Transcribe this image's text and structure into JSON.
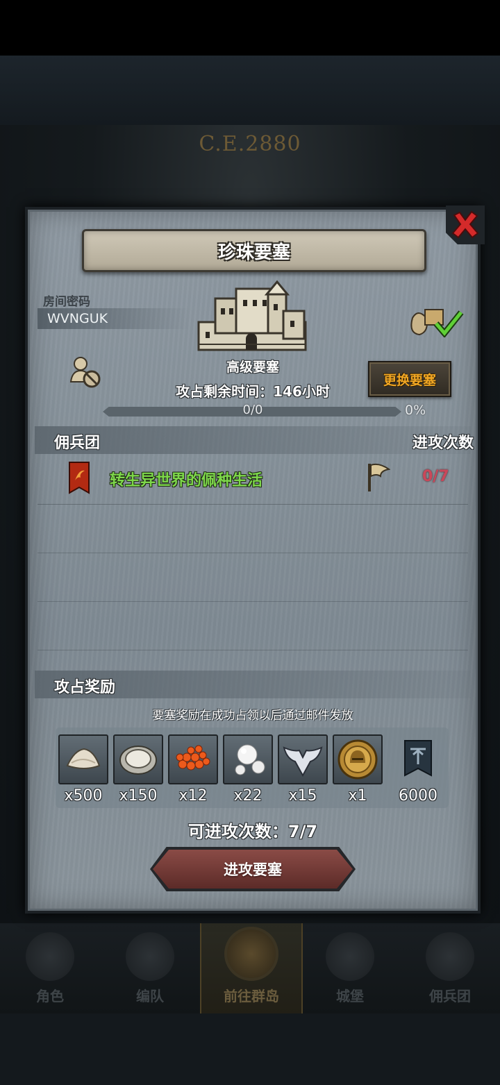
{
  "background": {
    "year_text": "C.E.2880"
  },
  "bottom_nav": {
    "items": [
      {
        "label": "角色",
        "icon": "knight-icon",
        "active": false
      },
      {
        "label": "编队",
        "icon": "helmet-icon",
        "active": false
      },
      {
        "label": "前往群岛",
        "icon": "globe-icon",
        "active": true
      },
      {
        "label": "城堡",
        "icon": "castle-icon",
        "active": false
      },
      {
        "label": "佣兵团",
        "icon": "warrior-icon",
        "active": false
      }
    ]
  },
  "dialog": {
    "title": "珍珠要塞",
    "room": {
      "label": "房间密码",
      "code": "WVNGUK"
    },
    "fortress": {
      "type": "高级要塞",
      "icon": "castle-icon",
      "change_button": "更换要塞",
      "remaining_time": "攻占剩余时间：146小时",
      "progress_text": "0/0",
      "progress_percent": "0%",
      "progress_value": 0
    },
    "mercenary_section": {
      "header_left": "佣兵团",
      "header_right": "进攻次数",
      "rows": [
        {
          "name": "转生异世界的佩种生活",
          "attacks": "0/7"
        }
      ]
    },
    "rewards": {
      "header": "攻占奖励",
      "note": "要塞奖励在成功占领以后通过邮件发放",
      "items": [
        {
          "icon": "flour-sack-icon",
          "qty": "x500"
        },
        {
          "icon": "oyster-icon",
          "qty": "x150"
        },
        {
          "icon": "fish-roe-icon",
          "qty": "x12"
        },
        {
          "icon": "pearl-icon",
          "qty": "x22"
        },
        {
          "icon": "wings-emblem-icon",
          "qty": "x15"
        },
        {
          "icon": "knight-medal-icon",
          "qty": "x1"
        },
        {
          "icon": "guild-banner-icon",
          "qty": "6000"
        }
      ]
    },
    "attack_count": "可进攻次数：7/7",
    "attack_button": "进攻要塞"
  },
  "colors": {
    "panel": "#8a959d",
    "accent_orange": "#f0a623",
    "merc_name_green": "#7ed84b",
    "attack_count_red": "#c9485a",
    "attack_button": "#7a403b",
    "close_red": "#d42a2a"
  }
}
